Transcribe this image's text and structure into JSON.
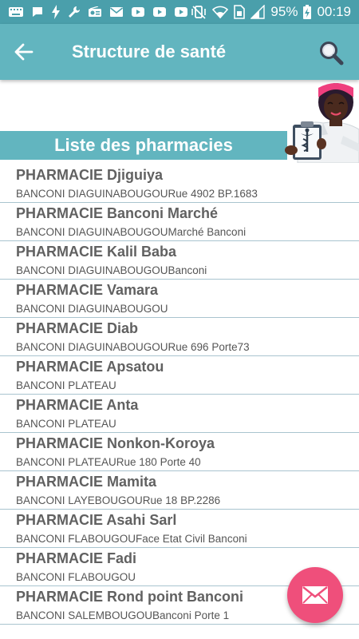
{
  "status_bar": {
    "battery_percent": "95%",
    "time": "00:19"
  },
  "app_bar": {
    "title": "Structure de santé",
    "back_icon": "arrow-left-icon",
    "search_icon": "search-icon"
  },
  "section": {
    "title": "Liste des pharmacies"
  },
  "pharmacies": [
    {
      "name": "PHARMACIE Djiguiya",
      "address": "BANCONI DIAGUINABOUGOURue 4902 BP.1683"
    },
    {
      "name": "PHARMACIE Banconi Marché",
      "address": "BANCONI DIAGUINABOUGOUMarché Banconi"
    },
    {
      "name": "PHARMACIE Kalil Baba",
      "address": "BANCONI DIAGUINABOUGOUBanconi"
    },
    {
      "name": "PHARMACIE Vamara",
      "address": "BANCONI DIAGUINABOUGOU"
    },
    {
      "name": "PHARMACIE Diab",
      "address": "BANCONI DIAGUINABOUGOURue 696 Porte73"
    },
    {
      "name": "PHARMACIE Apsatou",
      "address": "BANCONI PLATEAU"
    },
    {
      "name": "PHARMACIE Anta",
      "address": "BANCONI PLATEAU"
    },
    {
      "name": "PHARMACIE Nonkon-Koroya",
      "address": "BANCONI PLATEAURue 180 Porte 40"
    },
    {
      "name": "PHARMACIE Mamita",
      "address": "BANCONI LAYEBOUGOURue 18 BP.2286"
    },
    {
      "name": "PHARMACIE Asahi Sarl",
      "address": "BANCONI FLABOUGOUFace Etat Civil Banconi"
    },
    {
      "name": "PHARMACIE Fadi",
      "address": "BANCONI FLABOUGOU"
    },
    {
      "name": "PHARMACIE Rond point Banconi",
      "address": "BANCONI SALEMBOUGOUBanconi Porte 1"
    }
  ],
  "fab": {
    "icon": "mail-icon"
  },
  "colors": {
    "status_bar": "#4a9fab",
    "primary": "#62b5bf",
    "fab": "#ef4f7b",
    "divider": "#a9c4cf"
  }
}
